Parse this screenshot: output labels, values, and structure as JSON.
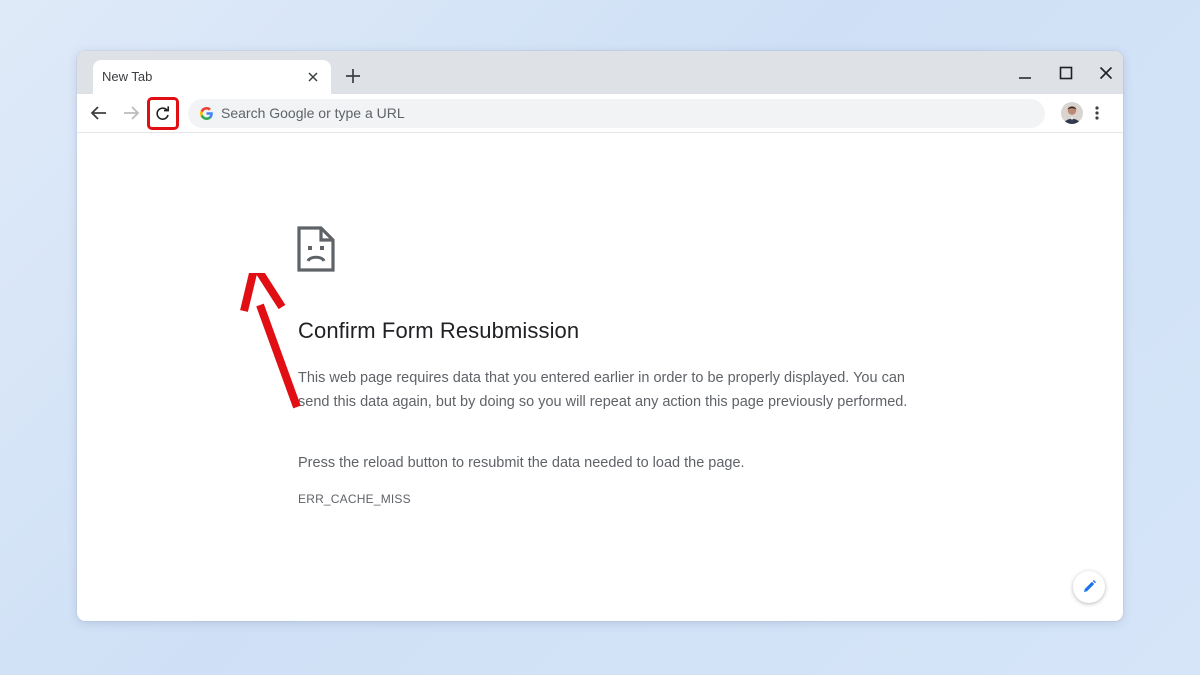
{
  "browser": {
    "tab": {
      "title": "New Tab",
      "close_icon": "close-icon"
    },
    "new_tab_icon": "plus-icon",
    "window_controls": [
      "minimize-icon",
      "maximize-icon",
      "close-icon"
    ],
    "toolbar": {
      "back_icon": "arrow-left-icon",
      "forward_icon": "arrow-right-icon",
      "reload_icon": "reload-icon",
      "omnibox_placeholder": "Search Google or type a URL",
      "omnibox_value": "",
      "menu_icon": "kebab-menu-icon"
    }
  },
  "page": {
    "icon": "sad-page-icon",
    "title": "Confirm Form Resubmission",
    "description": "This web page requires data that you entered earlier in order to be properly displayed. You can send this data again, but by doing so you will repeat any action this page previously performed.",
    "hint": "Press the reload button to resubmit the data needed to load the page.",
    "error_code": "ERR_CACHE_MISS"
  },
  "annotation": {
    "highlight_color": "#e10f14",
    "target": "reload button"
  },
  "colors": {
    "tabstrip": "#dee1e6",
    "omnibox": "#f1f3f4",
    "heading_text": "#202124",
    "body_text": "#5f6368",
    "edit_accent": "#1a73e8"
  }
}
